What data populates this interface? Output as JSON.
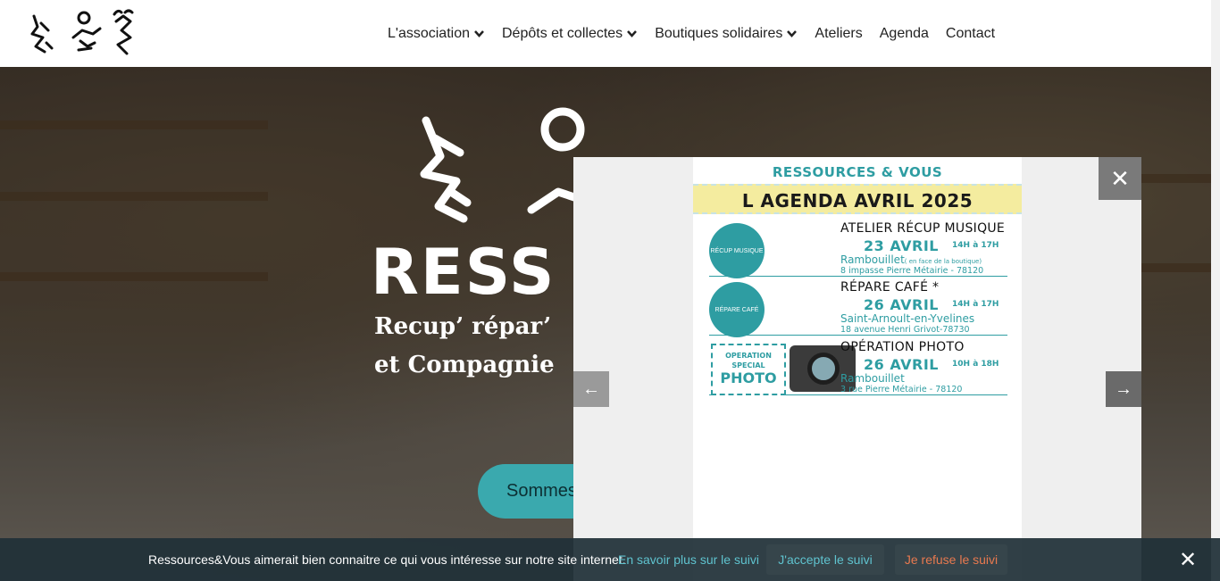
{
  "nav": {
    "items": [
      {
        "label": "L'association",
        "has_dropdown": true
      },
      {
        "label": "Dépôts et collectes",
        "has_dropdown": true
      },
      {
        "label": "Boutiques solidaires",
        "has_dropdown": true
      },
      {
        "label": "Ateliers",
        "has_dropdown": false
      },
      {
        "label": "Agenda",
        "has_dropdown": false
      },
      {
        "label": "Contact",
        "has_dropdown": false
      }
    ]
  },
  "hero": {
    "title": "RESS",
    "subtitle_line1": "Recup’ répar’",
    "subtitle_line2": "et Compagnie",
    "cta_label": "Sommes"
  },
  "lightbox": {
    "close_icon": "close-icon",
    "prev_icon": "arrow-left-icon",
    "next_icon": "arrow-right-icon",
    "poster": {
      "header": "RESSOURCES & VOUS",
      "banner": "L AGENDA AVRIL 2025",
      "events": [
        {
          "title": "ATELIER RÉCUP MUSIQUE",
          "date": "23 AVRIL",
          "hours": "14H à 17H",
          "place": "Rambouillet",
          "place_note": "( en face de la boutique)",
          "address": "8 impasse Pierre Métairie - 78120",
          "badge": "RÉCUP MUSIQUE"
        },
        {
          "title": "RÉPARE CAFÉ *",
          "date": "26 AVRIL",
          "hours": "14H à 17H",
          "place": "Saint-Arnoult-en-Yvelines",
          "place_note": "",
          "address": "18 avenue Henri Grivot-78730",
          "badge": "RÉPARE CAFÉ"
        },
        {
          "title": "OPÉRATION PHOTO",
          "date": "26 AVRIL",
          "hours": "10H à 18H",
          "place": "Rambouillet",
          "place_note": "",
          "address": "3 rue Pierre Métairie - 78120",
          "badge_line1": "OPERATION",
          "badge_line2": "SPECIAL",
          "badge_line3": "PHOTO"
        }
      ]
    }
  },
  "cookie": {
    "message": "Ressources&Vous aimerait bien connaitre ce qui vous intéresse sur notre site internet.",
    "more_link": "En savoir plus sur le suivi",
    "accept": "J'accepte le suivi",
    "refuse": "Je refuse le suivi"
  },
  "colors": {
    "accent": "#3aa9ae",
    "poster_teal": "#2e9da2",
    "poster_yellow": "#f4ec9f",
    "cookie_bg": "#203038",
    "cookie_link": "#5fc3cf",
    "cookie_refuse": "#e8794f"
  }
}
